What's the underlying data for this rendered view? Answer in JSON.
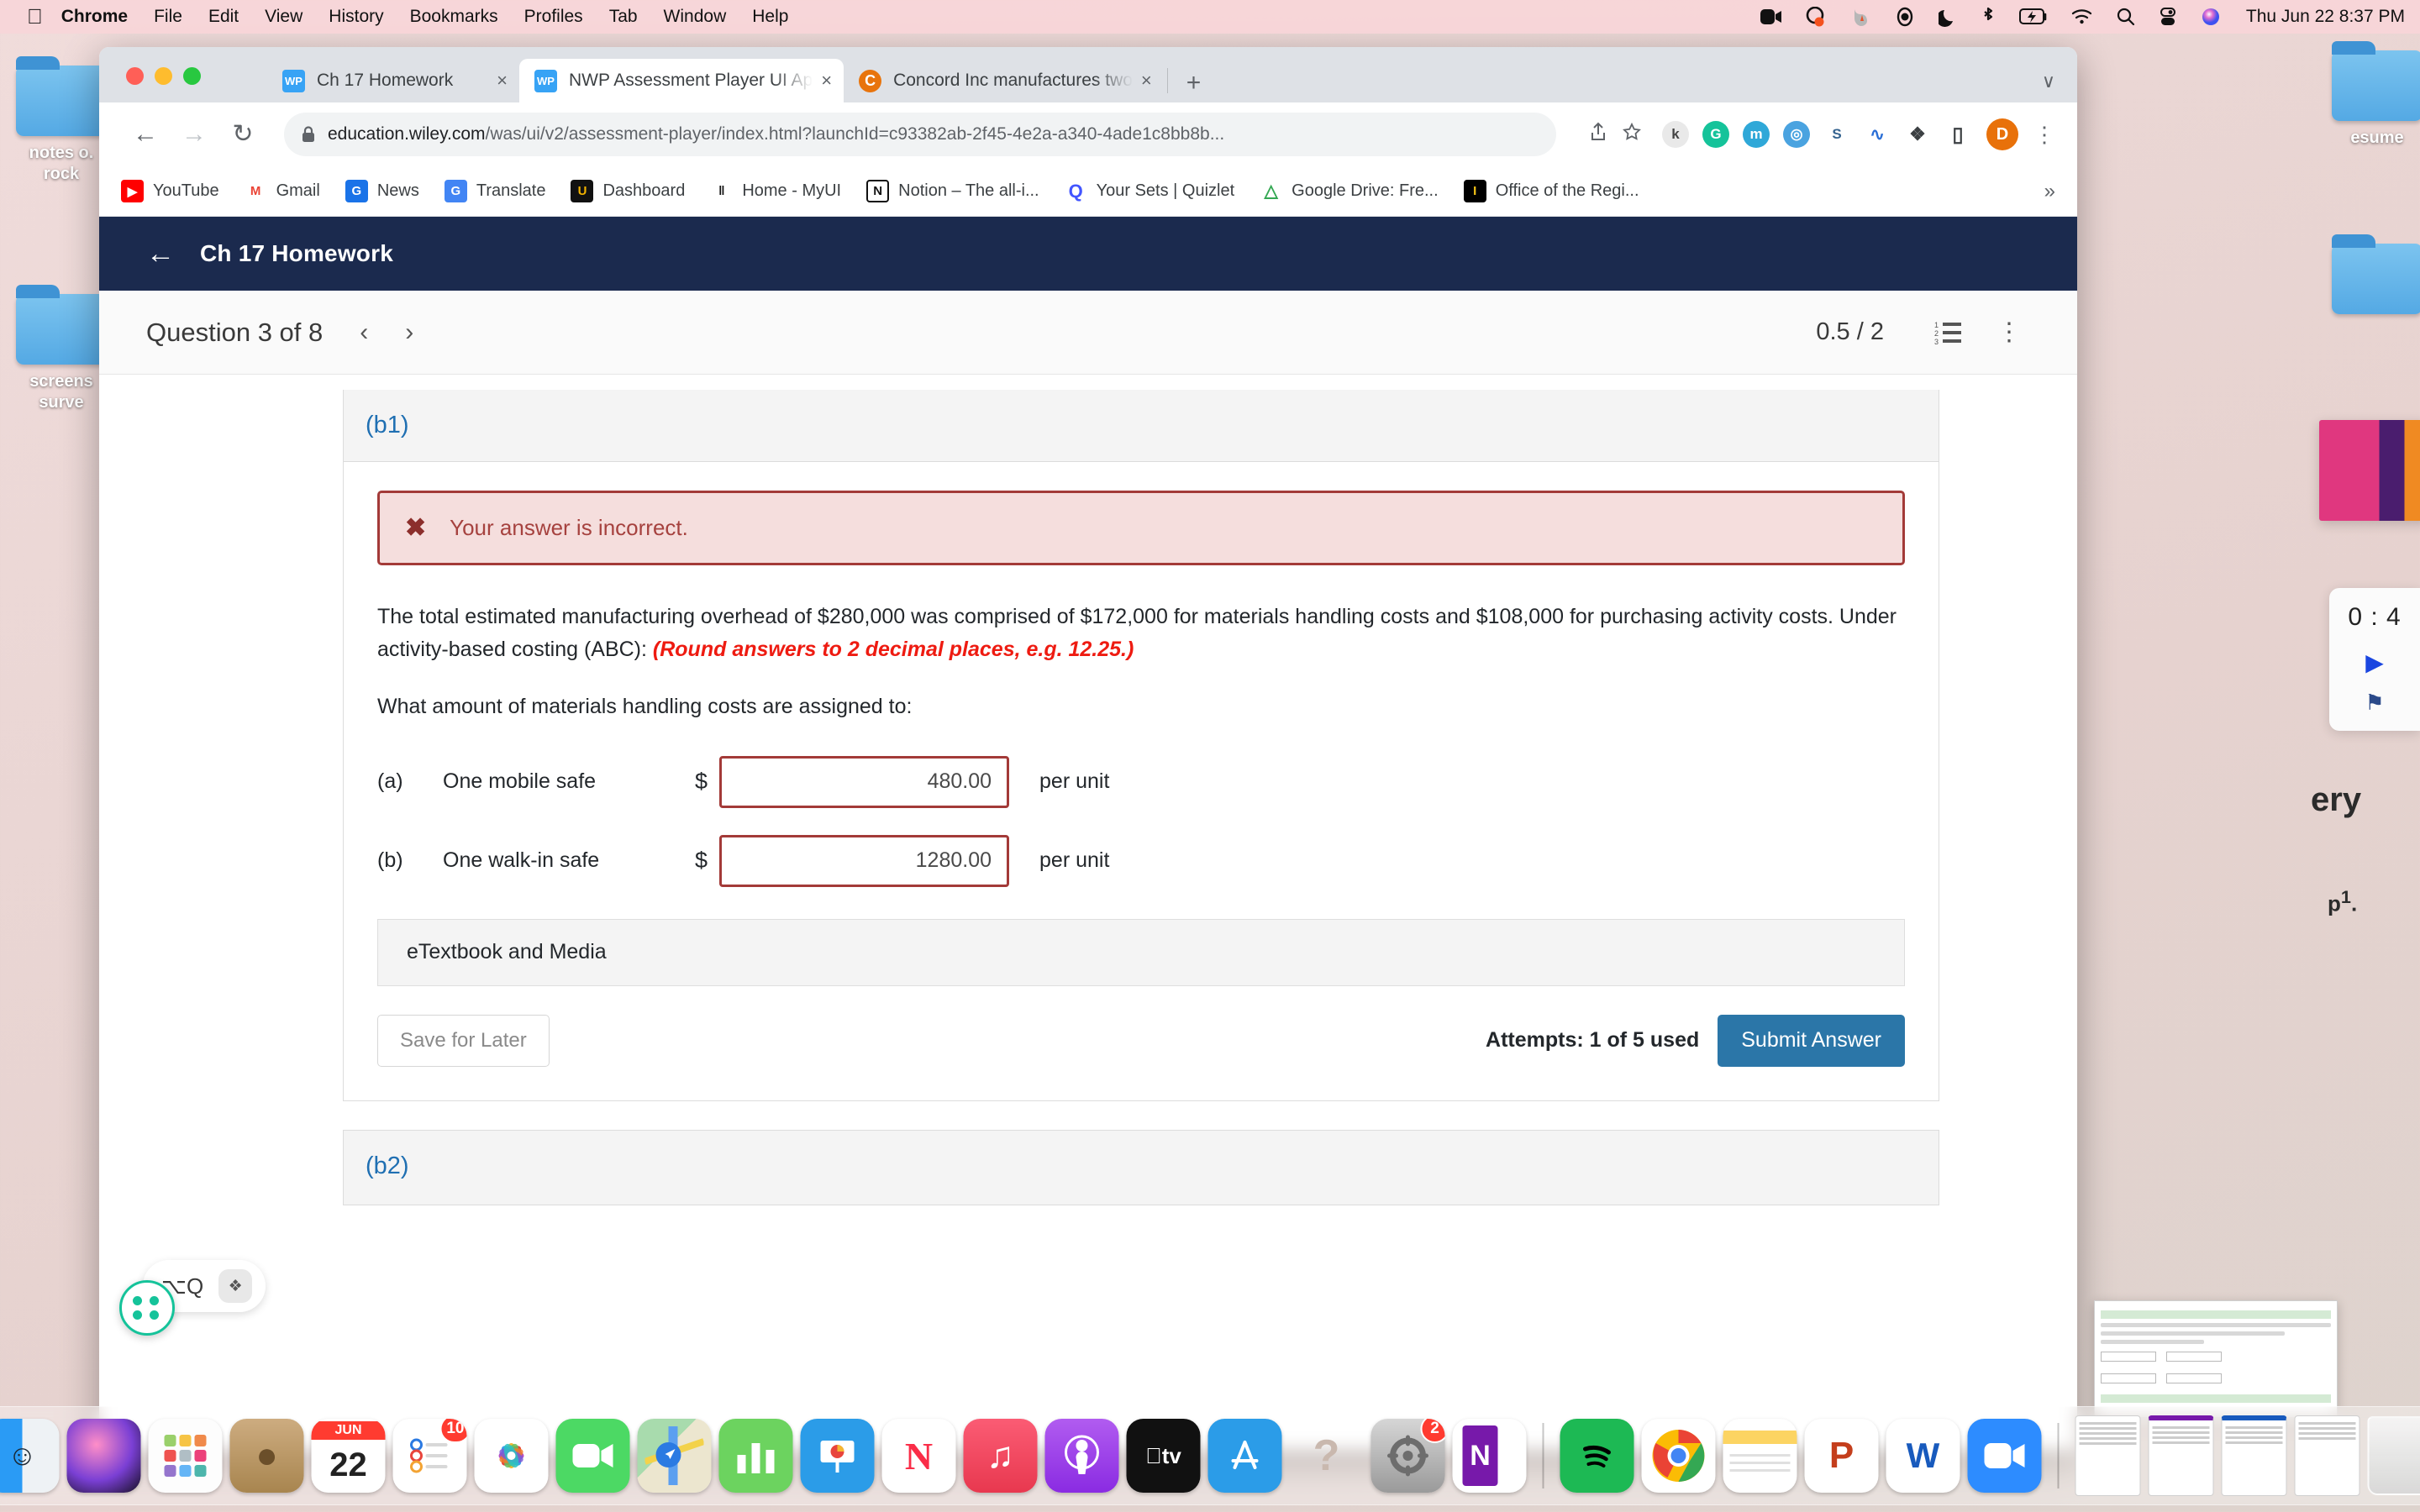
{
  "menubar": {
    "apple_icon": "apple-logo",
    "items": [
      {
        "label": "Chrome",
        "bold": true
      },
      {
        "label": "File",
        "bold": false
      },
      {
        "label": "Edit",
        "bold": false
      },
      {
        "label": "View",
        "bold": false
      },
      {
        "label": "History",
        "bold": false
      },
      {
        "label": "Bookmarks",
        "bold": false
      },
      {
        "label": "Profiles",
        "bold": false
      },
      {
        "label": "Tab",
        "bold": false
      },
      {
        "label": "Window",
        "bold": false
      },
      {
        "label": "Help",
        "bold": false
      }
    ],
    "status_icons": [
      "screen-record-icon",
      "loom-icon",
      "firefox-icon",
      "user-account-icon",
      "do-not-disturb-moon-icon",
      "bluetooth-icon",
      "battery-charging-icon",
      "wifi-icon",
      "spotlight-search-icon",
      "control-center-icon",
      "siri-icon"
    ],
    "clock": "Thu Jun 22  8:37 PM"
  },
  "desktop": {
    "folders": [
      {
        "label": "notes o.\nrock"
      },
      {
        "label": "screens\nsurve"
      }
    ],
    "right_text": "esume",
    "timer": {
      "value": "0 : 4",
      "play_icon": "play-icon",
      "flag_icon": "flag-icon"
    }
  },
  "browser": {
    "tabs": [
      {
        "title": "Ch 17 Homework",
        "favicon": "wiley-plus-icon",
        "active": false,
        "close": "×"
      },
      {
        "title": "NWP Assessment Player UI Ap",
        "favicon": "wiley-plus-icon",
        "active": true,
        "close": "×"
      },
      {
        "title": "Concord Inc manufactures two",
        "favicon": "chegg-icon",
        "active": false,
        "close": "×"
      }
    ],
    "new_tab_label": "+",
    "tabstrip_menu": "∨",
    "nav": {
      "back": "←",
      "forward": "→",
      "reload": "↻"
    },
    "omnibox": {
      "lock_icon": "lock-icon",
      "url_strong": "education.wiley.com",
      "url_dim": "/was/ui/v2/assessment-player/index.html?launchId=c93382ab-2f45-4e2a-a340-4ade1c8bb8b...",
      "share_icon": "share-icon",
      "star_icon": "bookmark-star-icon"
    },
    "extensions": [
      {
        "name": "kami-extension-icon",
        "glyph": "k",
        "color": "#e8e8e8",
        "fg": "#444"
      },
      {
        "name": "grammarly-extension-icon",
        "glyph": "G",
        "color": "#15c39a",
        "fg": "#fff"
      },
      {
        "name": "mercury-extension-icon",
        "glyph": "m",
        "color": "#2fa8d8",
        "fg": "#fff"
      },
      {
        "name": "honey-extension-icon",
        "glyph": "◎",
        "color": "#4aa3e0",
        "fg": "#fff"
      },
      {
        "name": "scribbr-extension-icon",
        "glyph": "S",
        "color": "#ffffff",
        "fg": "#3a6fb0"
      },
      {
        "name": "wave-extension-icon",
        "glyph": "∿",
        "color": "#ffffff",
        "fg": "#2b6fd6"
      },
      {
        "name": "puzzle-extensions-icon",
        "glyph": "❖",
        "color": "#ffffff",
        "fg": "#3c4043"
      },
      {
        "name": "sidepanel-icon",
        "glyph": "▭",
        "color": "#ffffff",
        "fg": "#3c4043"
      }
    ],
    "profile_avatar": "D",
    "menu_kebab": "⋮",
    "bookmarks": [
      {
        "label": "YouTube",
        "icon": "youtube-icon",
        "glyph": "▶",
        "bg": "#ff0000",
        "fg": "#fff"
      },
      {
        "label": "Gmail",
        "icon": "gmail-icon",
        "glyph": "M",
        "bg": "#ffffff",
        "fg": "#ea4335"
      },
      {
        "label": "News",
        "icon": "google-news-icon",
        "glyph": "G",
        "bg": "#1a73e8",
        "fg": "#fff"
      },
      {
        "label": "Translate",
        "icon": "google-translate-icon",
        "glyph": "G",
        "bg": "#4285f4",
        "fg": "#fff"
      },
      {
        "label": "Dashboard",
        "icon": "dashboard-icon",
        "glyph": "U",
        "bg": "#111111",
        "fg": "#f4b400"
      },
      {
        "label": "Home - MyUI",
        "icon": "myui-icon",
        "glyph": "‖",
        "bg": "#ffffff",
        "fg": "#111"
      },
      {
        "label": "Notion – The all-i...",
        "icon": "notion-icon",
        "glyph": "N",
        "bg": "#ffffff",
        "fg": "#111"
      },
      {
        "label": "Your Sets | Quizlet",
        "icon": "quizlet-icon",
        "glyph": "Q",
        "bg": "#ffffff",
        "fg": "#4255ff"
      },
      {
        "label": "Google Drive: Fre...",
        "icon": "google-drive-icon",
        "glyph": "△",
        "bg": "#ffffff",
        "fg": "#34a853"
      },
      {
        "label": "Office of the Regi...",
        "icon": "iowa-icon",
        "glyph": "I",
        "bg": "#000000",
        "fg": "#f5c518"
      }
    ],
    "bookmarks_overflow": "»"
  },
  "app": {
    "header": {
      "back_icon": "back-arrow-icon",
      "title": "Ch 17 Homework"
    },
    "question_bar": {
      "title": "Question 3 of 8",
      "prev_icon": "‹",
      "next_icon": "›",
      "score": "0.5 / 2",
      "list_icon": "numbered-list-icon",
      "more_icon": "⋮"
    },
    "part": {
      "label": "(b1)"
    },
    "alert": {
      "icon": "✖",
      "text": "Your answer is incorrect."
    },
    "question_text_1": "The total estimated manufacturing overhead of $280,000 was comprised of $172,000 for materials handling costs and $108,000 for purchasing activity costs. Under activity-based costing (ABC):",
    "question_emphasis": "(Round answers to 2 decimal places, e.g. 12.25.)",
    "question_text_2": "What amount of materials handling costs are assigned to:",
    "answers": [
      {
        "index": "(a)",
        "label": "One mobile safe",
        "currency": "$",
        "value": "480.00",
        "unit": "per unit"
      },
      {
        "index": "(b)",
        "label": "One walk-in safe",
        "currency": "$",
        "value": "1280.00",
        "unit": "per unit"
      }
    ],
    "etextbook_label": "eTextbook and Media",
    "save_label": "Save for Later",
    "attempts_label": "Attempts: 1 of 5 used",
    "submit_label": "Submit Answer",
    "next_part_label": "(b2)"
  },
  "grammarly": {
    "shortcut": "⌥Q",
    "button_icon": "❖",
    "ball_icon": "grammarly-dots-icon"
  },
  "dock": {
    "apps": [
      {
        "name": "finder-icon",
        "glyph": "☺",
        "bg": "linear-gradient(135deg,#2a9bf5 50%,#e9eef2 50%)",
        "fg": "#1c2833",
        "running": true
      },
      {
        "name": "siri-icon",
        "glyph": "",
        "bg": "radial-gradient(circle at 40% 35%,#ff7ab8,#7a3fd4 55%,#161022)",
        "fg": "#fff",
        "running": false
      },
      {
        "name": "launchpad-icon",
        "glyph": "⋮⋮",
        "bg": "#fdfdfd",
        "fg": "#888",
        "running": false
      },
      {
        "name": "contacts-icon",
        "glyph": "●",
        "bg": "linear-gradient(180deg,#c9a77a,#a8854f)",
        "fg": "#6b4f2a",
        "running": false
      },
      {
        "name": "calendar-icon",
        "glyph": "22",
        "bg": "#ffffff",
        "fg": "#222",
        "running": false
      },
      {
        "name": "reminders-icon",
        "glyph": "☰",
        "bg": "#ffffff",
        "fg": "#888",
        "running": false,
        "badge": "10"
      },
      {
        "name": "photos-icon",
        "glyph": "✿",
        "bg": "#ffffff",
        "fg": "#f4b400",
        "running": false
      },
      {
        "name": "facetime-icon",
        "glyph": "▶",
        "bg": "#4cd964",
        "fg": "#fff",
        "running": false
      },
      {
        "name": "maps-icon",
        "glyph": "➤",
        "bg": "linear-gradient(135deg,#9ad6a0,#e6e0c9)",
        "fg": "#2a7ae2",
        "running": false
      },
      {
        "name": "numbers-icon",
        "glyph": "█",
        "bg": "#6cd35f",
        "fg": "#fff",
        "running": false
      },
      {
        "name": "keynote-icon",
        "glyph": "◔",
        "bg": "#2b9ce8",
        "fg": "#fff",
        "running": false
      },
      {
        "name": "news-icon",
        "glyph": "N",
        "bg": "#ffffff",
        "fg": "#fa2d48",
        "running": false
      },
      {
        "name": "music-icon",
        "glyph": "♫",
        "bg": "linear-gradient(180deg,#fb5c74,#e8384f)",
        "fg": "#fff",
        "running": true
      },
      {
        "name": "podcasts-icon",
        "glyph": "ⓘ",
        "bg": "linear-gradient(180deg,#b15cf0,#8a2be2)",
        "fg": "#fff",
        "running": false
      },
      {
        "name": "appletv-icon",
        "glyph": "tv",
        "bg": "#111111",
        "fg": "#fff",
        "running": false
      },
      {
        "name": "app-store-icon",
        "glyph": "A",
        "bg": "#2b9ce8",
        "fg": "#fff",
        "running": false
      },
      {
        "name": "help-icon",
        "glyph": "?",
        "bg": "transparent",
        "fg": "#c9b8ae",
        "running": false
      },
      {
        "name": "system-preferences-icon",
        "glyph": "⚙",
        "bg": "linear-gradient(180deg,#cfcfcf,#9a9a9a)",
        "fg": "#555",
        "running": false,
        "badge": "2"
      },
      {
        "name": "onenote-icon",
        "glyph": "N",
        "bg": "#ffffff",
        "fg": "#7719aa",
        "running": true
      },
      {
        "name": "spotify-icon",
        "glyph": "♬",
        "bg": "#1db954",
        "fg": "#000",
        "running": true
      },
      {
        "name": "chrome-icon",
        "glyph": "●",
        "bg": "conic-gradient(#ea4335 0 33%,#fbbc05 33% 50%,#34a853 50% 75%,#4285f4 75%)",
        "fg": "#1a73e8",
        "running": true
      },
      {
        "name": "notes-icon",
        "glyph": "☰",
        "bg": "#ffffff",
        "fg": "#c9c9c9",
        "running": false
      },
      {
        "name": "powerpoint-icon",
        "glyph": "P",
        "bg": "#ffffff",
        "fg": "#c43e1c",
        "running": true
      },
      {
        "name": "word-icon",
        "glyph": "W",
        "bg": "#ffffff",
        "fg": "#185abd",
        "running": true
      },
      {
        "name": "zoom-icon",
        "glyph": "▶",
        "bg": "#2d8cff",
        "fg": "#fff",
        "running": true
      }
    ],
    "minimized_windows": [
      "notes-minimized-window",
      "onenote-minimized-window",
      "word-minimized-window",
      "chrome-minimized-window"
    ],
    "trash": "trash-icon"
  }
}
